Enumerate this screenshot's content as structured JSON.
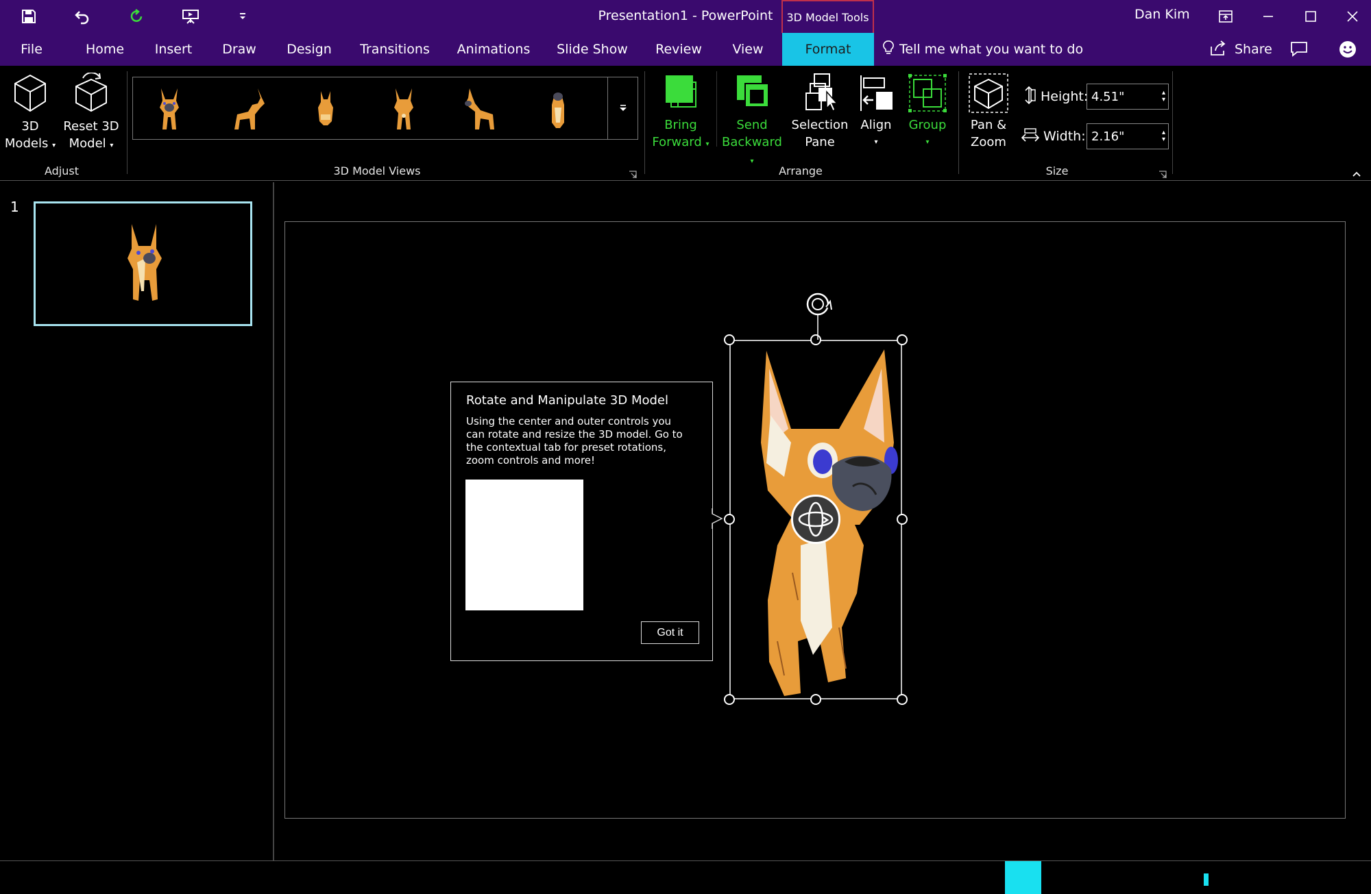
{
  "window": {
    "title": "Presentation1  -  PowerPoint",
    "context_tab_group": "3D Model Tools",
    "user": "Dan Kim"
  },
  "tabs": [
    {
      "label": "File"
    },
    {
      "label": "Home"
    },
    {
      "label": "Insert"
    },
    {
      "label": "Draw"
    },
    {
      "label": "Design"
    },
    {
      "label": "Transitions"
    },
    {
      "label": "Animations"
    },
    {
      "label": "Slide Show"
    },
    {
      "label": "Review"
    },
    {
      "label": "View"
    },
    {
      "label": "Format"
    }
  ],
  "active_tab": "Format",
  "tell_me": "Tell me what you want to do",
  "share": "Share",
  "ribbon": {
    "adjust": {
      "label": "Adjust",
      "models_1": "3D",
      "models_2": "Models",
      "reset_1": "Reset 3D",
      "reset_2": "Model"
    },
    "views": {
      "label": "3D Model Views"
    },
    "arrange": {
      "label": "Arrange",
      "bring_1": "Bring",
      "bring_2": "Forward",
      "send_1": "Send",
      "send_2": "Backward",
      "selection_1": "Selection",
      "selection_2": "Pane",
      "align": "Align",
      "group": "Group"
    },
    "size": {
      "label": "Size",
      "pan_1": "Pan &",
      "pan_2": "Zoom",
      "height_label": "Height:",
      "height_value": "4.51\"",
      "width_label": "Width:",
      "width_value": "2.16\""
    }
  },
  "slides": [
    {
      "number": "1"
    }
  ],
  "tooltip": {
    "title": "Rotate and Manipulate 3D Model",
    "body": "Using the center and outer controls you can rotate and resize the 3D model. Go to the contextual tab for preset rotations, zoom controls and more!",
    "button": "Got it"
  },
  "colors": {
    "titlebar": "#3a0a6e",
    "active_tab": "#19c4e6",
    "accent_green": "#3bdc3b",
    "thumb_border": "#a8e4f0"
  }
}
